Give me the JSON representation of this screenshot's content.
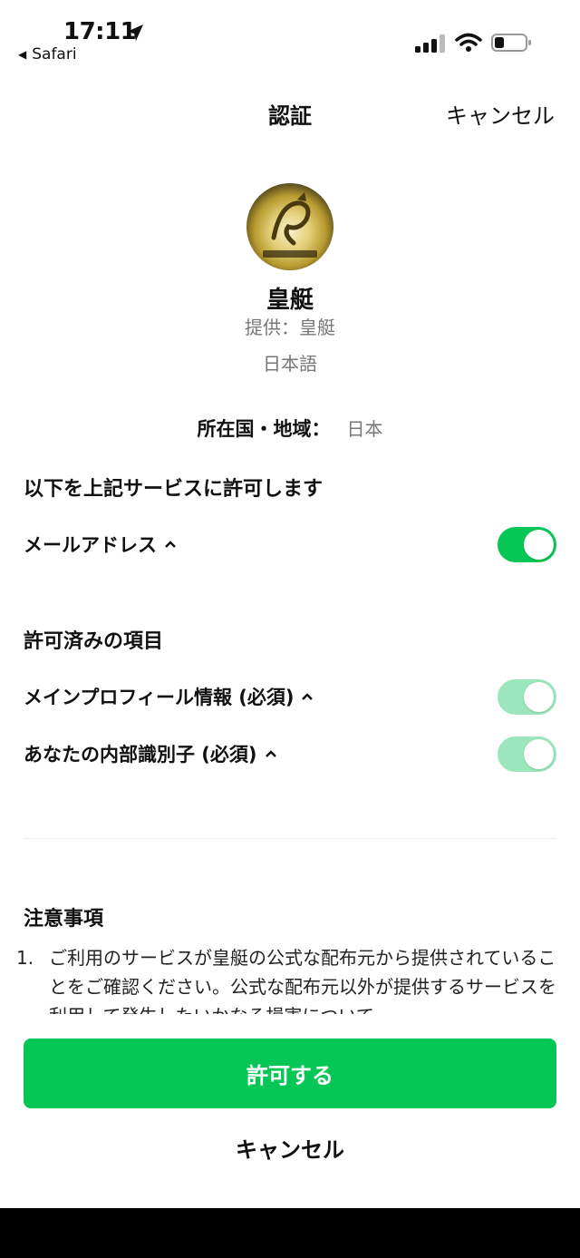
{
  "status_bar": {
    "time": "17:11",
    "back_app": "Safari"
  },
  "nav": {
    "title": "認証",
    "cancel": "キャンセル"
  },
  "service": {
    "name": "皇艇",
    "provider": "提供：皇艇",
    "language": "日本語"
  },
  "region": {
    "label": "所在国・地域：",
    "value": "日本"
  },
  "grant_section": {
    "title": "以下を上記サービスに許可します",
    "items": [
      {
        "label": "メールアドレス",
        "enabled": true
      }
    ]
  },
  "granted_section": {
    "title": "許可済みの項目",
    "items": [
      {
        "label": "メインプロフィール情報 (必須)",
        "enabled": true,
        "locked": true
      },
      {
        "label": "あなたの内部識別子 (必須)",
        "enabled": true,
        "locked": true
      }
    ]
  },
  "notes": {
    "title": "注意事項",
    "items": [
      {
        "num": "1.",
        "text": "ご利用のサービスが皇艇の公式な配布元から提供されていることをご確認ください。公式な配布元以外が提供するサービスを利用して発生したいかなる損害について"
      }
    ]
  },
  "actions": {
    "allow": "許可する",
    "cancel": "キャンセル"
  },
  "colors": {
    "accent": "#06c755",
    "accent_disabled": "#9be6bc"
  }
}
